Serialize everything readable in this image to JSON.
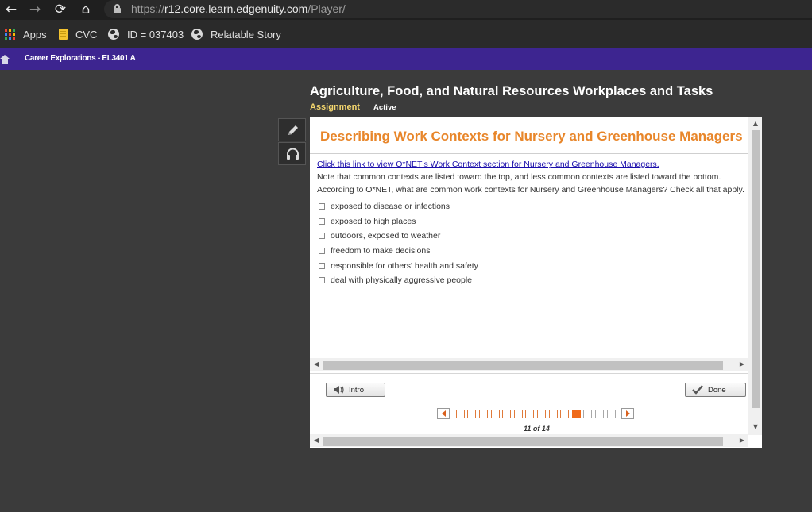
{
  "browser": {
    "url_scheme": "https://",
    "url_host": "r12.core.learn.edgenuity.com",
    "url_path": "/Player/",
    "bookmarks": [
      {
        "label": "Apps",
        "icon": "apps-grid-icon"
      },
      {
        "label": "CVC",
        "icon": "bookmark-page-icon"
      },
      {
        "label": "ID = 037403",
        "icon": "globe-icon"
      },
      {
        "label": "Relatable Story",
        "icon": "globe-icon"
      }
    ]
  },
  "course": {
    "title": "Career Explorations - EL3401 A"
  },
  "activity": {
    "title": "Agriculture, Food, and Natural Resources Workplaces and Tasks",
    "type_label": "Assignment",
    "status": "Active"
  },
  "content": {
    "title": "Describing Work Contexts for Nursery and Greenhouse Managers",
    "link_text": "Click this link to view O*NET's Work Context section for Nursery and Greenhouse Managers.",
    "note": "Note that common contexts are listed toward the top, and less common contexts are listed toward the bottom.",
    "question": "According to O*NET, what are common work contexts for Nursery and Greenhouse Managers? Check all that apply.",
    "options": [
      {
        "label": "exposed to disease or infections",
        "checked": false
      },
      {
        "label": "exposed to high places",
        "checked": false
      },
      {
        "label": "outdoors, exposed to weather",
        "checked": false
      },
      {
        "label": "freedom to make decisions",
        "checked": false
      },
      {
        "label": "responsible for others' health and safety",
        "checked": false
      },
      {
        "label": "deal with physically aggressive people",
        "checked": false
      }
    ]
  },
  "footer": {
    "intro_label": "Intro",
    "done_label": "Done"
  },
  "pagination": {
    "current": 11,
    "total": 14,
    "label": "11 of 14"
  },
  "colors": {
    "course_bar": "#3d2590",
    "content_title": "#e8862a",
    "assignment_label": "#f5d76e",
    "current_page": "#ef6a1a"
  }
}
